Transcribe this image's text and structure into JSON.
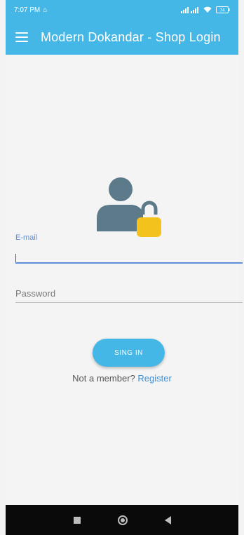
{
  "status_bar": {
    "time": "7:07 PM",
    "battery": "74"
  },
  "app_bar": {
    "title": "Modern Dokandar - Shop Login",
    "menu_icon": "hamburger-menu-icon"
  },
  "form": {
    "email_label": "E-mail",
    "email_value": "",
    "password_placeholder": "Password",
    "signin_label": "SING IN",
    "not_member_text": "Not a member?",
    "register_label": "Register"
  },
  "nav": {
    "recent_icon": "square-recents-icon",
    "home_icon": "circle-home-icon",
    "back_icon": "triangle-back-icon"
  },
  "colors": {
    "primary": "#45b7e6",
    "accent_blue": "#5b8fdb",
    "icon_gray": "#5d7a8a",
    "lock_yellow": "#f4c21d"
  }
}
